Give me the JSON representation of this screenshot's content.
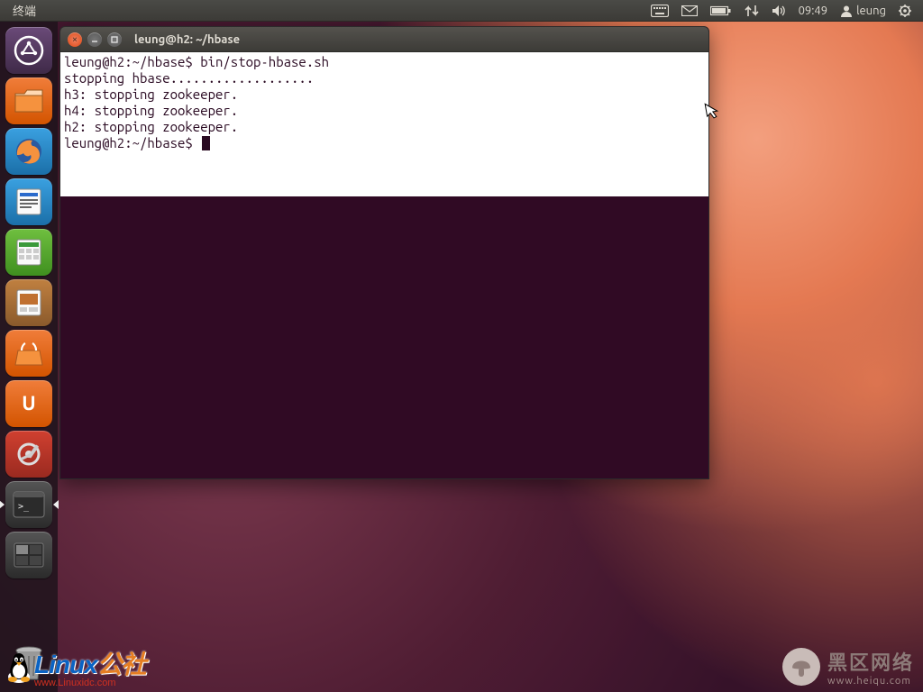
{
  "panel": {
    "app_label": "终端",
    "clock": "09:49",
    "username": "leung"
  },
  "launcher": {
    "items": [
      {
        "name": "dash",
        "label": "Dash"
      },
      {
        "name": "files",
        "label": "Files"
      },
      {
        "name": "firefox",
        "label": "Firefox"
      },
      {
        "name": "writer",
        "label": "LibreOffice Writer"
      },
      {
        "name": "calc",
        "label": "LibreOffice Calc"
      },
      {
        "name": "impress",
        "label": "LibreOffice Impress"
      },
      {
        "name": "software",
        "label": "Ubuntu Software"
      },
      {
        "name": "ubuntuone",
        "label": "Ubuntu One"
      },
      {
        "name": "settings",
        "label": "System Settings"
      },
      {
        "name": "terminal",
        "label": "Terminal"
      },
      {
        "name": "workspace",
        "label": "Workspace Switcher"
      }
    ]
  },
  "terminal": {
    "title": "leung@h2: ~/hbase",
    "lines": [
      "leung@h2:~/hbase$ bin/stop-hbase.sh",
      "stopping hbase...................",
      "h3: stopping zookeeper.",
      "h4: stopping zookeeper.",
      "h2: stopping zookeeper.",
      "leung@h2:~/hbase$ "
    ]
  },
  "watermarks": {
    "left_brand_main": "Linux",
    "left_brand_suffix": "公社",
    "left_url": "www.Linuxidc.com",
    "right_cn": "黑区网络",
    "right_url": "www.heiqu.com"
  }
}
